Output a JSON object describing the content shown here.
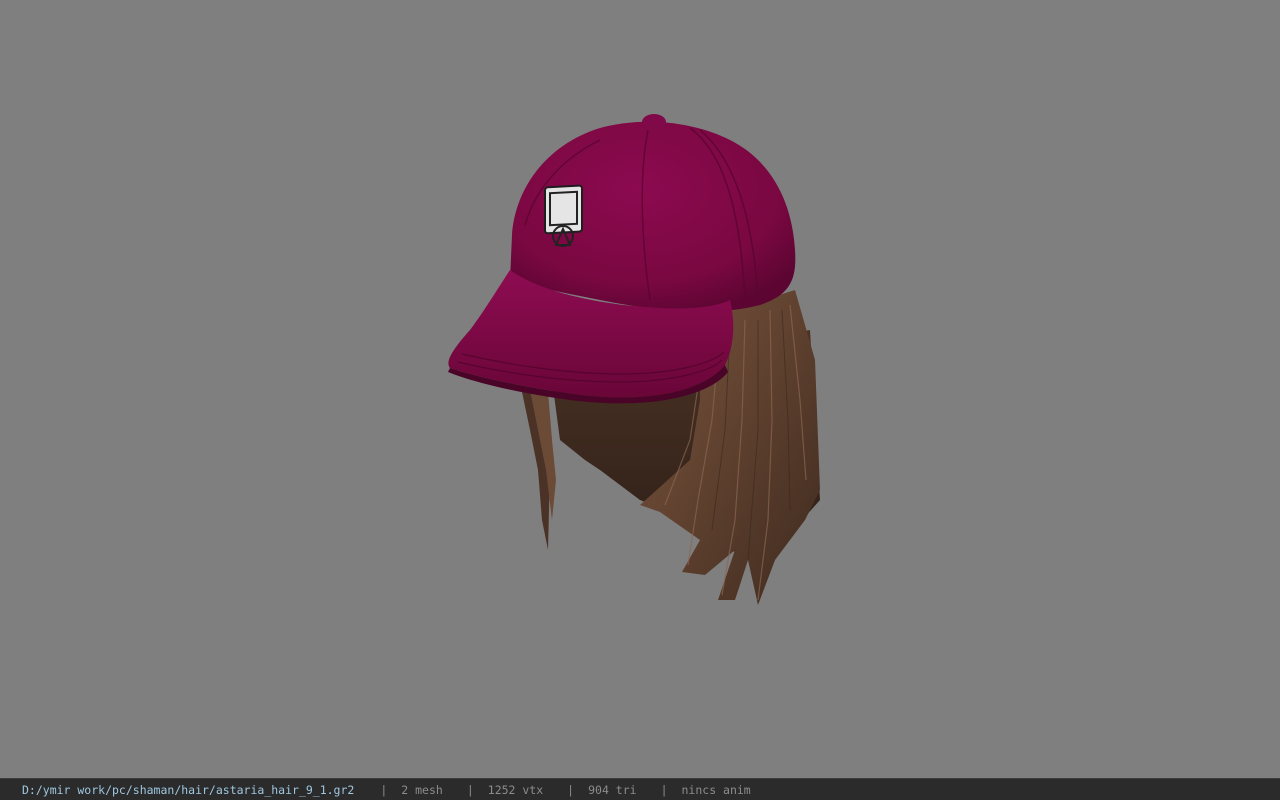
{
  "viewport": {
    "background": "#7f7f7f",
    "model_icon": "cap-with-hair-model"
  },
  "colors": {
    "cap": "#8a0a4a",
    "hair": "#6a4a36",
    "statusbar_bg": "#2b2b2b",
    "path_text": "#9ec7e0"
  },
  "status": {
    "file_path": "D:/ymir work/pc/shaman/hair/astaria_hair_9_1.gr2",
    "separator": "|",
    "mesh_count": "2 mesh",
    "vertex_count": "1252 vtx",
    "triangle_count": "904 tri",
    "anim_info": "nincs anim"
  }
}
